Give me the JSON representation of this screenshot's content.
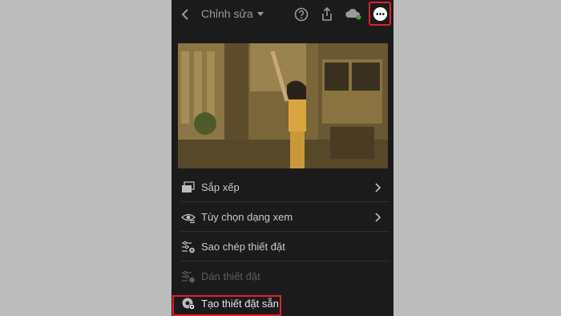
{
  "header": {
    "title": "Chỉnh sửa"
  },
  "icons": {
    "back": "chevron-left-icon",
    "title_dropdown": "caret-down-icon",
    "help": "help-circle-icon",
    "share": "share-icon",
    "cloud": "cloud-sync-icon",
    "more": "more-horizontal-icon"
  },
  "menu": {
    "items": [
      {
        "label": "Sắp xếp",
        "icon": "folders-icon",
        "has_submenu": true,
        "enabled": true
      },
      {
        "label": "Tùy chọn dạng xem",
        "icon": "eye-options-icon",
        "has_submenu": true,
        "enabled": true
      },
      {
        "label": "Sao chép thiết đặt",
        "icon": "copy-settings-icon",
        "has_submenu": false,
        "enabled": true
      },
      {
        "label": "Dán thiết đặt",
        "icon": "paste-settings-icon",
        "has_submenu": false,
        "enabled": false
      },
      {
        "label": "Tạo thiết đặt sẵn",
        "icon": "create-preset-icon",
        "has_submenu": false,
        "enabled": true
      }
    ]
  },
  "colors": {
    "background": "#bcbcbc",
    "panel": "#1b1b1b",
    "highlight": "#e0212a",
    "text": "#c9c9c9",
    "text_disabled": "#5b5b5b"
  }
}
